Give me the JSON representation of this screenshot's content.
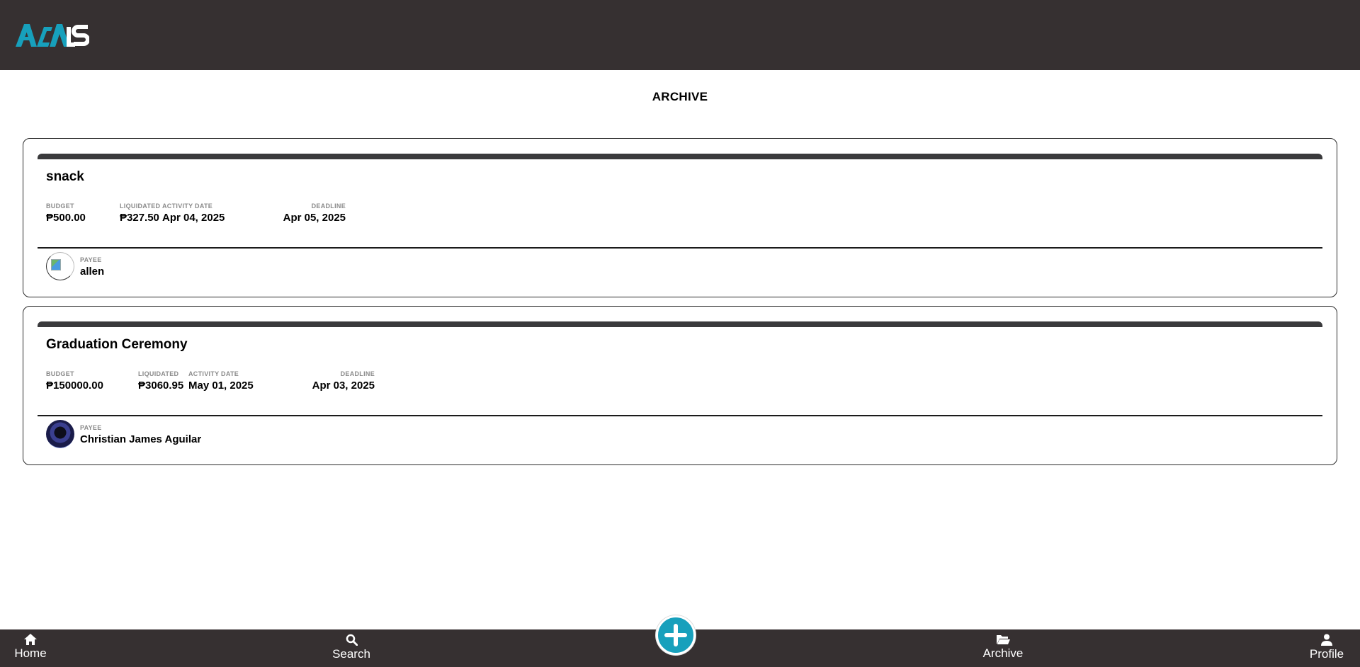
{
  "app": {
    "logo_alt": "ACALS"
  },
  "page": {
    "title": "ARCHIVE"
  },
  "labels": {
    "budget": "BUDGET",
    "liquidated": "LIQUIDATED",
    "activity_date": "ACTIVITY DATE",
    "deadline": "DEADLINE",
    "payee": "PAYEE"
  },
  "cards": [
    {
      "title": "snack",
      "budget": "₱500.00",
      "liquidated": "₱327.50",
      "activity_date": "Apr 04, 2025",
      "deadline": "Apr 05, 2025",
      "payee": "allen",
      "avatar": "broken-image"
    },
    {
      "title": "Graduation Ceremony",
      "budget": "₱150000.00",
      "liquidated": "₱3060.95",
      "activity_date": "May 01, 2025",
      "deadline": "Apr 03, 2025",
      "payee": "Christian James Aguilar",
      "avatar": "photo"
    }
  ],
  "nav": {
    "home": "Home",
    "search": "Search",
    "archive": "Archive",
    "profile": "Profile",
    "add_icon": "plus-icon"
  },
  "colors": {
    "header": "#363031",
    "accent": "#17a0bc"
  }
}
